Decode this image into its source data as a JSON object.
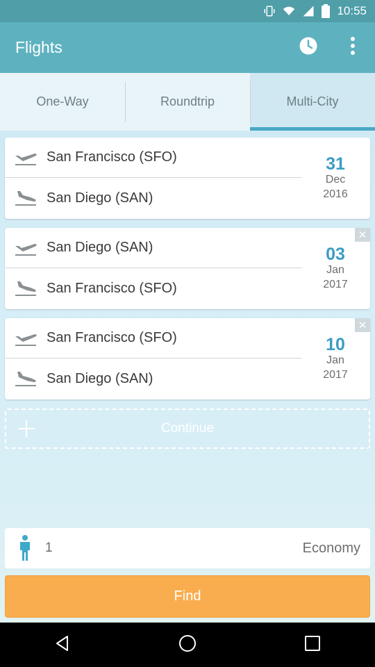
{
  "status_bar": {
    "time": "10:55"
  },
  "app_bar": {
    "title": "Flights"
  },
  "tabs": [
    {
      "label": "One-Way"
    },
    {
      "label": "Roundtrip"
    },
    {
      "label": "Multi-City"
    }
  ],
  "legs": [
    {
      "from": "San Francisco (SFO)",
      "to": "San Diego (SAN)",
      "day": "31",
      "month": "Dec",
      "year": "2016"
    },
    {
      "from": "San Diego (SAN)",
      "to": "San Francisco (SFO)",
      "day": "03",
      "month": "Jan",
      "year": "2017"
    },
    {
      "from": "San Francisco (SFO)",
      "to": "San Diego (SAN)",
      "day": "10",
      "month": "Jan",
      "year": "2017"
    }
  ],
  "continue_label": "Continue",
  "passengers": {
    "count": "1",
    "cabin": "Economy"
  },
  "find_label": "Find",
  "colors": {
    "app_bar": "#5eb2c0",
    "accent": "#3c9cc4",
    "find_button": "#f9ad4f"
  },
  "icons": {
    "history": "clock-icon",
    "menu": "more-vert-icon",
    "departure": "plane-takeoff-icon",
    "arrival": "plane-landing-icon",
    "add": "plus-icon",
    "passenger": "person-icon",
    "remove": "close-icon"
  }
}
